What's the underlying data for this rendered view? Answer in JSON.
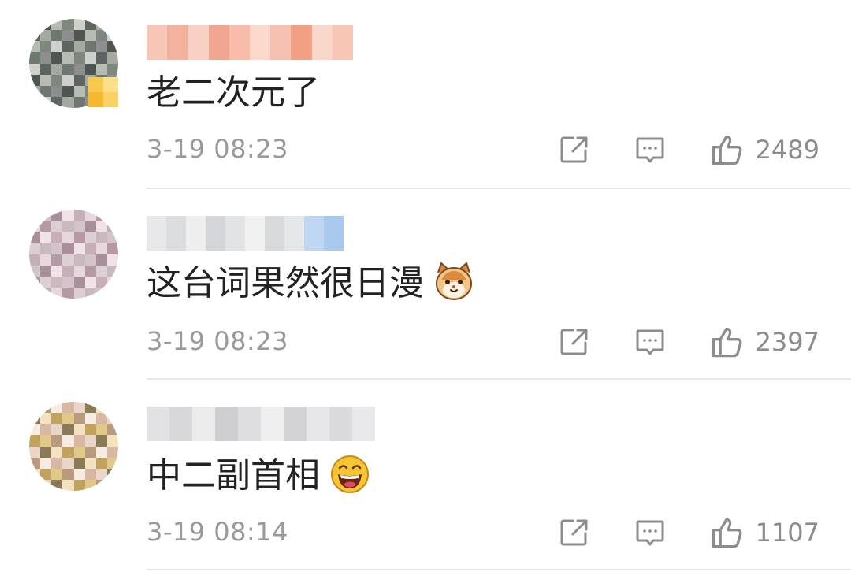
{
  "comments": [
    {
      "text": "老二次元了",
      "time": "3-19 08:23",
      "likes": "2489",
      "avatar_colors": [
        "#8e8e8e",
        "#6f7771",
        "#a6a8a2",
        "#5e6560",
        "#cfd0cc",
        "#7e8680",
        "#b8bab4",
        "#4f5552"
      ],
      "name_colors": [
        "#f6c7b6",
        "#f3b29e",
        "#f9d1c4",
        "#f1a691",
        "#f7bcaa",
        "#fbd8cc",
        "#f5c1b0",
        "#f29f84",
        "#f9d7ca",
        "#f7c6b6"
      ],
      "has_vip_badge": true,
      "emoji": null
    },
    {
      "text": "这台词果然很日漫",
      "time": "3-19 08:23",
      "likes": "2397",
      "avatar_colors": [
        "#c9b8be",
        "#dccfd4",
        "#b59aa5",
        "#e6d7dc",
        "#c7aeb8",
        "#efe3e7",
        "#a98f9b",
        "#d4c3ca"
      ],
      "name_colors": [
        "#e8e8ea",
        "#dcdde0",
        "#eeeeef",
        "#d5d6d9",
        "#e2e3e5",
        "#f0f0f1",
        "#d9dadc",
        "#e6e7e9",
        "#bfd6f3",
        "#aac9ee"
      ],
      "has_vip_badge": false,
      "emoji": "cat-face-emoji"
    },
    {
      "text": "中二副首相",
      "time": "3-19 08:14",
      "likes": "1107",
      "avatar_colors": [
        "#e1c98a",
        "#c2a35e",
        "#f2e2c0",
        "#8a7a55",
        "#e9d6c8",
        "#d8b8a3",
        "#f6ece3",
        "#b99a7d"
      ],
      "name_colors": [
        "#e2e2e4",
        "#d7d7da",
        "#ebebec",
        "#cfcfd3",
        "#dedee1",
        "#efeff0",
        "#d3d3d6",
        "#e7e7e9",
        "#dadadd",
        "#e9e9eb"
      ],
      "has_vip_badge": false,
      "emoji": "laughing-face-emoji"
    }
  ],
  "colors": {
    "text": "#222222",
    "meta": "#9a9a9a",
    "icon": "#8c8c8c",
    "divider": "#e8e8e8"
  }
}
